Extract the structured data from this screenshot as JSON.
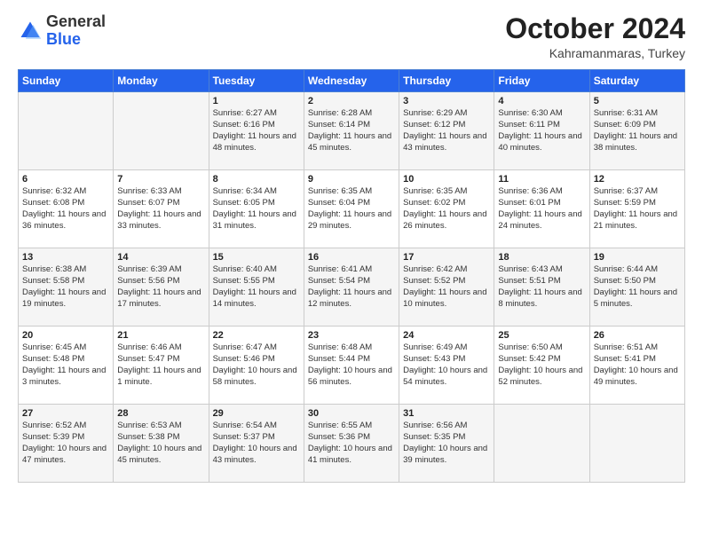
{
  "header": {
    "logo": {
      "general": "General",
      "blue": "Blue"
    },
    "title": "October 2024",
    "location": "Kahramanmaras, Turkey"
  },
  "columns": [
    "Sunday",
    "Monday",
    "Tuesday",
    "Wednesday",
    "Thursday",
    "Friday",
    "Saturday"
  ],
  "weeks": [
    [
      {
        "day": "",
        "sunrise": "",
        "sunset": "",
        "daylight": ""
      },
      {
        "day": "",
        "sunrise": "",
        "sunset": "",
        "daylight": ""
      },
      {
        "day": "1",
        "sunrise": "Sunrise: 6:27 AM",
        "sunset": "Sunset: 6:16 PM",
        "daylight": "Daylight: 11 hours and 48 minutes."
      },
      {
        "day": "2",
        "sunrise": "Sunrise: 6:28 AM",
        "sunset": "Sunset: 6:14 PM",
        "daylight": "Daylight: 11 hours and 45 minutes."
      },
      {
        "day": "3",
        "sunrise": "Sunrise: 6:29 AM",
        "sunset": "Sunset: 6:12 PM",
        "daylight": "Daylight: 11 hours and 43 minutes."
      },
      {
        "day": "4",
        "sunrise": "Sunrise: 6:30 AM",
        "sunset": "Sunset: 6:11 PM",
        "daylight": "Daylight: 11 hours and 40 minutes."
      },
      {
        "day": "5",
        "sunrise": "Sunrise: 6:31 AM",
        "sunset": "Sunset: 6:09 PM",
        "daylight": "Daylight: 11 hours and 38 minutes."
      }
    ],
    [
      {
        "day": "6",
        "sunrise": "Sunrise: 6:32 AM",
        "sunset": "Sunset: 6:08 PM",
        "daylight": "Daylight: 11 hours and 36 minutes."
      },
      {
        "day": "7",
        "sunrise": "Sunrise: 6:33 AM",
        "sunset": "Sunset: 6:07 PM",
        "daylight": "Daylight: 11 hours and 33 minutes."
      },
      {
        "day": "8",
        "sunrise": "Sunrise: 6:34 AM",
        "sunset": "Sunset: 6:05 PM",
        "daylight": "Daylight: 11 hours and 31 minutes."
      },
      {
        "day": "9",
        "sunrise": "Sunrise: 6:35 AM",
        "sunset": "Sunset: 6:04 PM",
        "daylight": "Daylight: 11 hours and 29 minutes."
      },
      {
        "day": "10",
        "sunrise": "Sunrise: 6:35 AM",
        "sunset": "Sunset: 6:02 PM",
        "daylight": "Daylight: 11 hours and 26 minutes."
      },
      {
        "day": "11",
        "sunrise": "Sunrise: 6:36 AM",
        "sunset": "Sunset: 6:01 PM",
        "daylight": "Daylight: 11 hours and 24 minutes."
      },
      {
        "day": "12",
        "sunrise": "Sunrise: 6:37 AM",
        "sunset": "Sunset: 5:59 PM",
        "daylight": "Daylight: 11 hours and 21 minutes."
      }
    ],
    [
      {
        "day": "13",
        "sunrise": "Sunrise: 6:38 AM",
        "sunset": "Sunset: 5:58 PM",
        "daylight": "Daylight: 11 hours and 19 minutes."
      },
      {
        "day": "14",
        "sunrise": "Sunrise: 6:39 AM",
        "sunset": "Sunset: 5:56 PM",
        "daylight": "Daylight: 11 hours and 17 minutes."
      },
      {
        "day": "15",
        "sunrise": "Sunrise: 6:40 AM",
        "sunset": "Sunset: 5:55 PM",
        "daylight": "Daylight: 11 hours and 14 minutes."
      },
      {
        "day": "16",
        "sunrise": "Sunrise: 6:41 AM",
        "sunset": "Sunset: 5:54 PM",
        "daylight": "Daylight: 11 hours and 12 minutes."
      },
      {
        "day": "17",
        "sunrise": "Sunrise: 6:42 AM",
        "sunset": "Sunset: 5:52 PM",
        "daylight": "Daylight: 11 hours and 10 minutes."
      },
      {
        "day": "18",
        "sunrise": "Sunrise: 6:43 AM",
        "sunset": "Sunset: 5:51 PM",
        "daylight": "Daylight: 11 hours and 8 minutes."
      },
      {
        "day": "19",
        "sunrise": "Sunrise: 6:44 AM",
        "sunset": "Sunset: 5:50 PM",
        "daylight": "Daylight: 11 hours and 5 minutes."
      }
    ],
    [
      {
        "day": "20",
        "sunrise": "Sunrise: 6:45 AM",
        "sunset": "Sunset: 5:48 PM",
        "daylight": "Daylight: 11 hours and 3 minutes."
      },
      {
        "day": "21",
        "sunrise": "Sunrise: 6:46 AM",
        "sunset": "Sunset: 5:47 PM",
        "daylight": "Daylight: 11 hours and 1 minute."
      },
      {
        "day": "22",
        "sunrise": "Sunrise: 6:47 AM",
        "sunset": "Sunset: 5:46 PM",
        "daylight": "Daylight: 10 hours and 58 minutes."
      },
      {
        "day": "23",
        "sunrise": "Sunrise: 6:48 AM",
        "sunset": "Sunset: 5:44 PM",
        "daylight": "Daylight: 10 hours and 56 minutes."
      },
      {
        "day": "24",
        "sunrise": "Sunrise: 6:49 AM",
        "sunset": "Sunset: 5:43 PM",
        "daylight": "Daylight: 10 hours and 54 minutes."
      },
      {
        "day": "25",
        "sunrise": "Sunrise: 6:50 AM",
        "sunset": "Sunset: 5:42 PM",
        "daylight": "Daylight: 10 hours and 52 minutes."
      },
      {
        "day": "26",
        "sunrise": "Sunrise: 6:51 AM",
        "sunset": "Sunset: 5:41 PM",
        "daylight": "Daylight: 10 hours and 49 minutes."
      }
    ],
    [
      {
        "day": "27",
        "sunrise": "Sunrise: 6:52 AM",
        "sunset": "Sunset: 5:39 PM",
        "daylight": "Daylight: 10 hours and 47 minutes."
      },
      {
        "day": "28",
        "sunrise": "Sunrise: 6:53 AM",
        "sunset": "Sunset: 5:38 PM",
        "daylight": "Daylight: 10 hours and 45 minutes."
      },
      {
        "day": "29",
        "sunrise": "Sunrise: 6:54 AM",
        "sunset": "Sunset: 5:37 PM",
        "daylight": "Daylight: 10 hours and 43 minutes."
      },
      {
        "day": "30",
        "sunrise": "Sunrise: 6:55 AM",
        "sunset": "Sunset: 5:36 PM",
        "daylight": "Daylight: 10 hours and 41 minutes."
      },
      {
        "day": "31",
        "sunrise": "Sunrise: 6:56 AM",
        "sunset": "Sunset: 5:35 PM",
        "daylight": "Daylight: 10 hours and 39 minutes."
      },
      {
        "day": "",
        "sunrise": "",
        "sunset": "",
        "daylight": ""
      },
      {
        "day": "",
        "sunrise": "",
        "sunset": "",
        "daylight": ""
      }
    ]
  ]
}
